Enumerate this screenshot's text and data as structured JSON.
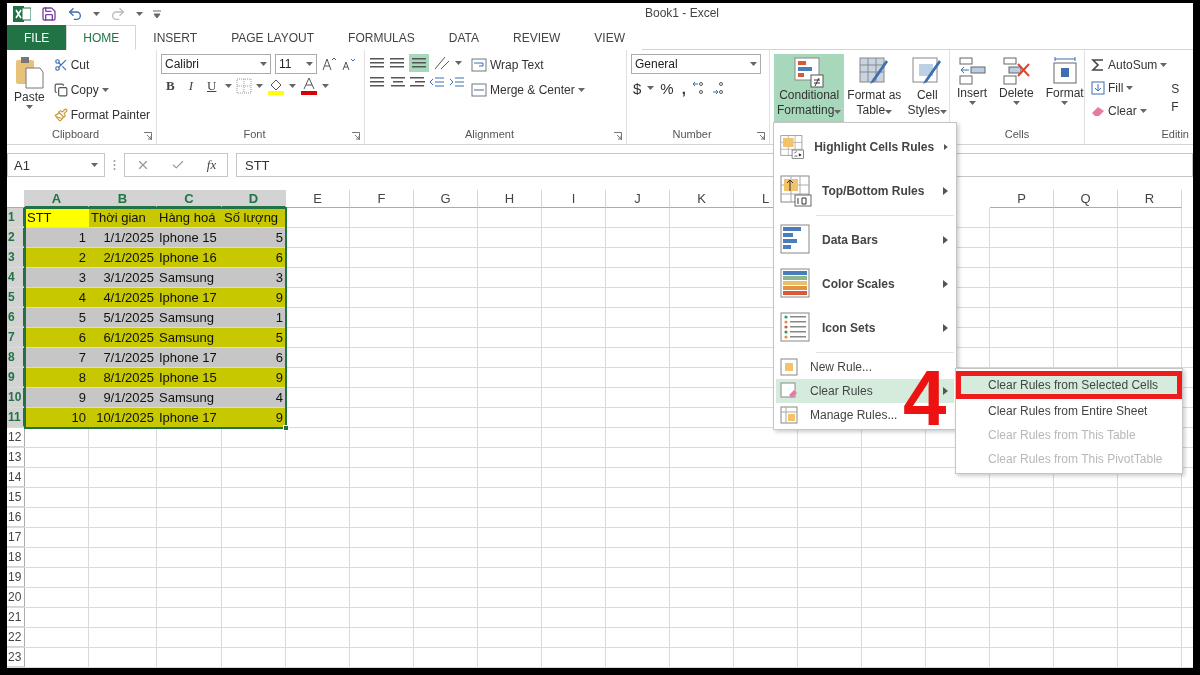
{
  "title_bar": {
    "title": "Book1 - Excel"
  },
  "tabs": [
    {
      "label": "FILE",
      "kind": "file",
      "selected": false
    },
    {
      "label": "HOME",
      "kind": "tab",
      "selected": true
    },
    {
      "label": "INSERT",
      "kind": "tab",
      "selected": false
    },
    {
      "label": "PAGE LAYOUT",
      "kind": "tab",
      "selected": false
    },
    {
      "label": "FORMULAS",
      "kind": "tab",
      "selected": false
    },
    {
      "label": "DATA",
      "kind": "tab",
      "selected": false
    },
    {
      "label": "REVIEW",
      "kind": "tab",
      "selected": false
    },
    {
      "label": "VIEW",
      "kind": "tab",
      "selected": false
    }
  ],
  "clipboard": {
    "paste": "Paste",
    "cut": "Cut",
    "copy": "Copy",
    "format_painter": "Format Painter",
    "label": "Clipboard"
  },
  "font": {
    "name": "Calibri",
    "size": "11",
    "bold": "B",
    "italic": "I",
    "underline": "U",
    "label": "Font"
  },
  "alignment": {
    "wrap_text": "Wrap Text",
    "merge_center": "Merge & Center",
    "label": "Alignment"
  },
  "number": {
    "format": "General",
    "currency": "$",
    "percent": "%",
    "comma": ",",
    "label": "Number"
  },
  "styles": [
    {
      "lines": [
        "Conditional",
        "Formatting"
      ],
      "selected": true
    },
    {
      "lines": [
        "Format as",
        "Table"
      ],
      "selected": false
    },
    {
      "lines": [
        "Cell",
        "Styles"
      ],
      "selected": false
    }
  ],
  "cells_group": {
    "buttons": [
      "Insert",
      "Delete",
      "Format"
    ],
    "label": "Cells"
  },
  "editing": {
    "autosum": "AutoSum",
    "fill": "Fill",
    "clear": "Clear",
    "label": "Editin",
    "cut_lines": [
      "S",
      "F"
    ]
  },
  "formula_bar": {
    "name_box": "A1",
    "fx": "fx",
    "value": "STT"
  },
  "columns": [
    {
      "label": "A",
      "selected": true
    },
    {
      "label": "B",
      "selected": true
    },
    {
      "label": "C",
      "selected": true
    },
    {
      "label": "D",
      "selected": true
    },
    {
      "label": "E",
      "selected": false
    },
    {
      "label": "F",
      "selected": false
    },
    {
      "label": "G",
      "selected": false
    },
    {
      "label": "H",
      "selected": false
    },
    {
      "label": "I",
      "selected": false
    },
    {
      "label": "J",
      "selected": false
    },
    {
      "label": "K",
      "selected": false
    },
    {
      "label": "L",
      "selected": false
    },
    {
      "label": "P",
      "selected": false
    },
    {
      "label": "Q",
      "selected": false
    },
    {
      "label": "R",
      "selected": false
    }
  ],
  "rows": [
    {
      "header": "1",
      "selected": true,
      "color": "#c8c800",
      "cells": [
        {
          "text": "STT",
          "kind": "text",
          "color": "#ffff00"
        },
        {
          "text": "Thời gian",
          "kind": "text"
        },
        {
          "text": "Hàng hoá",
          "kind": "text"
        },
        {
          "text": "Số lượng",
          "kind": "text"
        }
      ]
    },
    {
      "header": "2",
      "selected": true,
      "color": "#c6c6c6",
      "cells": [
        {
          "text": "1",
          "kind": "number"
        },
        {
          "text": "1/1/2025",
          "kind": "number"
        },
        {
          "text": "Iphone 15",
          "kind": "text"
        },
        {
          "text": "5",
          "kind": "number"
        }
      ]
    },
    {
      "header": "3",
      "selected": true,
      "color": "#c8c800",
      "cells": [
        {
          "text": "2",
          "kind": "number"
        },
        {
          "text": "2/1/2025",
          "kind": "number"
        },
        {
          "text": "Iphone 16",
          "kind": "text"
        },
        {
          "text": "6",
          "kind": "number"
        }
      ]
    },
    {
      "header": "4",
      "selected": true,
      "color": "#c6c6c6",
      "cells": [
        {
          "text": "3",
          "kind": "number"
        },
        {
          "text": "3/1/2025",
          "kind": "number"
        },
        {
          "text": "Samsung",
          "kind": "text"
        },
        {
          "text": "3",
          "kind": "number"
        }
      ]
    },
    {
      "header": "5",
      "selected": true,
      "color": "#c8c800",
      "cells": [
        {
          "text": "4",
          "kind": "number"
        },
        {
          "text": "4/1/2025",
          "kind": "number"
        },
        {
          "text": "Iphone 17",
          "kind": "text"
        },
        {
          "text": "9",
          "kind": "number"
        }
      ]
    },
    {
      "header": "6",
      "selected": true,
      "color": "#c6c6c6",
      "cells": [
        {
          "text": "5",
          "kind": "number"
        },
        {
          "text": "5/1/2025",
          "kind": "number"
        },
        {
          "text": "Samsung",
          "kind": "text"
        },
        {
          "text": "1",
          "kind": "number"
        }
      ]
    },
    {
      "header": "7",
      "selected": true,
      "color": "#c8c800",
      "cells": [
        {
          "text": "6",
          "kind": "number"
        },
        {
          "text": "6/1/2025",
          "kind": "number"
        },
        {
          "text": "Samsung",
          "kind": "text"
        },
        {
          "text": "5",
          "kind": "number"
        }
      ]
    },
    {
      "header": "8",
      "selected": true,
      "color": "#c6c6c6",
      "cells": [
        {
          "text": "7",
          "kind": "number"
        },
        {
          "text": "7/1/2025",
          "kind": "number"
        },
        {
          "text": "Iphone 17",
          "kind": "text"
        },
        {
          "text": "6",
          "kind": "number"
        }
      ]
    },
    {
      "header": "9",
      "selected": true,
      "color": "#c8c800",
      "cells": [
        {
          "text": "8",
          "kind": "number"
        },
        {
          "text": "8/1/2025",
          "kind": "number"
        },
        {
          "text": "Iphone 15",
          "kind": "text"
        },
        {
          "text": "9",
          "kind": "number"
        }
      ]
    },
    {
      "header": "10",
      "selected": true,
      "color": "#c6c6c6",
      "cells": [
        {
          "text": "9",
          "kind": "number"
        },
        {
          "text": "9/1/2025",
          "kind": "number"
        },
        {
          "text": "Samsung",
          "kind": "text"
        },
        {
          "text": "4",
          "kind": "number"
        }
      ]
    },
    {
      "header": "11",
      "selected": true,
      "color": "#c8c800",
      "cells": [
        {
          "text": "10",
          "kind": "number"
        },
        {
          "text": "10/1/2025",
          "kind": "number"
        },
        {
          "text": "Iphone 17",
          "kind": "text"
        },
        {
          "text": "9",
          "kind": "number"
        }
      ]
    },
    {
      "header": "12",
      "selected": false
    },
    {
      "header": "13",
      "selected": false
    },
    {
      "header": "14",
      "selected": false
    },
    {
      "header": "15",
      "selected": false
    },
    {
      "header": "16",
      "selected": false
    },
    {
      "header": "17",
      "selected": false
    },
    {
      "header": "18",
      "selected": false
    },
    {
      "header": "19",
      "selected": false
    },
    {
      "header": "20",
      "selected": false
    },
    {
      "header": "21",
      "selected": false
    },
    {
      "header": "22",
      "selected": false
    },
    {
      "header": "23",
      "selected": false
    }
  ],
  "menu": [
    {
      "label": "Highlight Cells Rules",
      "kind": "large",
      "submenu": true,
      "selected": false
    },
    {
      "label": "Top/Bottom Rules",
      "kind": "large",
      "submenu": true,
      "selected": false
    },
    {
      "label": "Data Bars",
      "kind": "large",
      "submenu": true,
      "selected": false
    },
    {
      "label": "Color Scales",
      "kind": "large",
      "submenu": true,
      "selected": false
    },
    {
      "label": "Icon Sets",
      "kind": "large",
      "submenu": true,
      "selected": false
    },
    {
      "label": "New Rule...",
      "kind": "small",
      "submenu": false,
      "selected": false
    },
    {
      "label": "Clear Rules",
      "kind": "small",
      "submenu": true,
      "selected": true
    },
    {
      "label": "Manage Rules...",
      "kind": "small",
      "submenu": false,
      "selected": false
    }
  ],
  "submenu": [
    {
      "label": "Clear Rules from Selected Cells",
      "selected": true,
      "disabled": false
    },
    {
      "label": "Clear Rules from Entire Sheet",
      "selected": false,
      "disabled": false
    },
    {
      "label": "Clear Rules from This Table",
      "selected": false,
      "disabled": true
    },
    {
      "label": "Clear Rules from This PivotTable",
      "selected": false,
      "disabled": true
    }
  ],
  "annotation": {
    "label": "4"
  }
}
